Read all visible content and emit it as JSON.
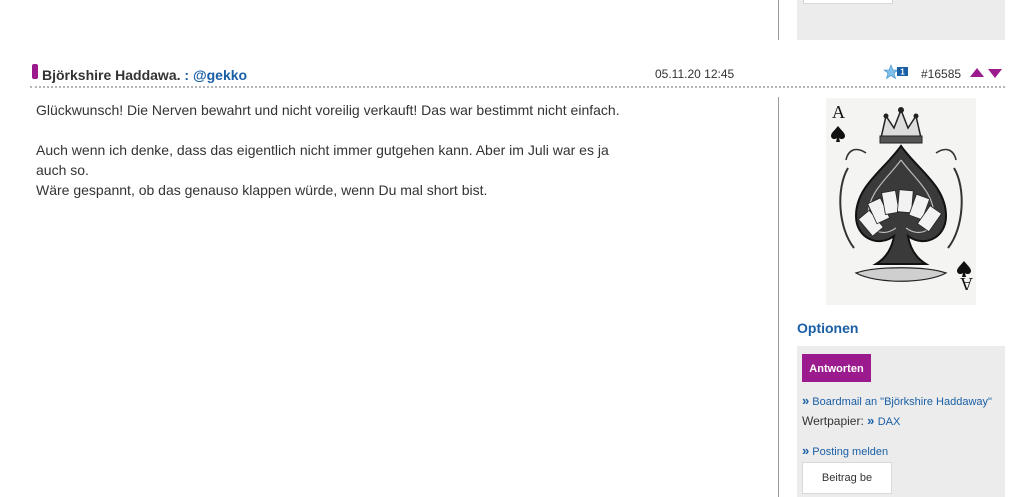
{
  "post": {
    "author": "Björkshire Haddawa.",
    "separator": " : ",
    "reply_to": "@gekko",
    "date": "05.11.20 12:45",
    "star_count": "1",
    "post_number": "#16585",
    "paragraphs": [
      "Glückwunsch! Die Nerven bewahrt und nicht voreilig verkauft! Das war bestimmt nicht einfach.",
      "Auch wenn ich denke, dass das eigentlich nicht immer gutgehen kann. Aber im Juli war es ja auch so.",
      "Wäre gespannt, ob das genauso klappen würde, wenn Du mal short bist."
    ]
  },
  "sidebar": {
    "avatar_icon": "ace-of-spades-avatar",
    "options_title": "Optionen",
    "reply_label": "Antworten",
    "link_marker": "»",
    "boardmail_label": "Boardmail an \"Björkshire Haddaway\"",
    "wertpapier_label": "Wertpapier:",
    "wertpapier_value": "DAX",
    "report_label": "Posting melden",
    "save_label": "Beitrag be"
  },
  "colors": {
    "accent": "#9b1b8e",
    "link": "#1a5fa6",
    "panel": "#ececec"
  }
}
